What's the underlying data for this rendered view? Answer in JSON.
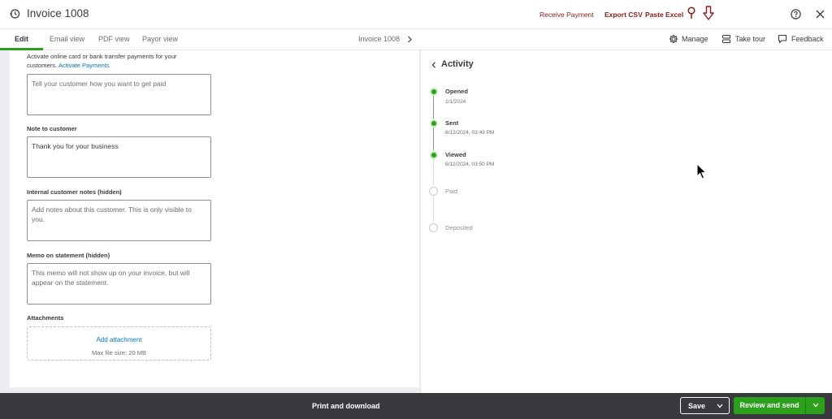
{
  "header": {
    "title": "Invoice 1008",
    "receive_payment": "Receive Payment",
    "export_csv": "Export CSV",
    "paste_excel": "Paste Excel"
  },
  "tabs": [
    {
      "label": "Edit",
      "active": true
    },
    {
      "label": "Email view",
      "active": false
    },
    {
      "label": "PDF view",
      "active": false
    },
    {
      "label": "Payor view",
      "active": false
    }
  ],
  "breadcrumb": "Invoice 1008",
  "tools": {
    "manage": "Manage",
    "take_tour": "Take tour",
    "feedback": "Feedback"
  },
  "form": {
    "payments_text": "Activate online card or bank transfer payments for your customers.",
    "payments_link": "Activate Payments",
    "payment_instructions": {
      "placeholder": "Tell your customer how you want to get paid"
    },
    "note_to_customer": {
      "label": "Note to customer",
      "value": "Thank you for your business"
    },
    "internal_notes": {
      "label": "Internal customer notes (hidden)",
      "placeholder": "Add notes about this customer. This is only visible to you."
    },
    "memo": {
      "label": "Memo on statement (hidden)",
      "placeholder": "This memo will not show up on your invoice, but will appear on the statement."
    },
    "attachments": {
      "label": "Attachments",
      "add_link": "Add attachment",
      "max_size": "Max file size: 20 MB"
    }
  },
  "activity": {
    "title": "Activity",
    "events": [
      {
        "label": "Opened",
        "date": "1/1/2024",
        "done": true
      },
      {
        "label": "Sent",
        "date": "6/12/2024, 03:49 PM",
        "done": true
      },
      {
        "label": "Viewed",
        "date": "6/12/2024, 03:50 PM",
        "done": true
      },
      {
        "label": "Paid",
        "date": "",
        "done": false
      },
      {
        "label": "Deposited",
        "date": "",
        "done": false
      }
    ]
  },
  "footer": {
    "print_download": "Print and download",
    "save": "Save",
    "review_send": "Review and send"
  },
  "colors": {
    "accent_green": "#2ca01c",
    "link_blue": "#0077c5",
    "top_link_red": "#8b1a1a",
    "footer_bg": "#393a3d"
  }
}
